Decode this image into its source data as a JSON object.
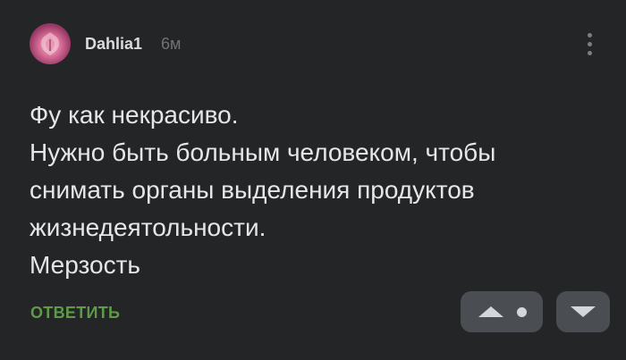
{
  "comment": {
    "author": "Dahlia1",
    "time": "6м",
    "text_lines": [
      "Фу как некрасиво.",
      "Нужно быть больным человеком, чтобы",
      "снимать органы выделения продуктов",
      "жизнедеятольности.",
      "Мерзость"
    ],
    "reply_label": "ОТВЕТИТЬ"
  },
  "icons": {
    "more": "more-vertical-icon",
    "upvote": "triangle-up-icon",
    "downvote": "triangle-down-icon",
    "rating": "neutral-rating-dot-icon"
  },
  "colors": {
    "background": "#232527",
    "text": "#e5e6e8",
    "username": "#d9dbde",
    "time": "#6f7378",
    "reply": "#5f9a48",
    "vote_button": "#4a4d52"
  }
}
